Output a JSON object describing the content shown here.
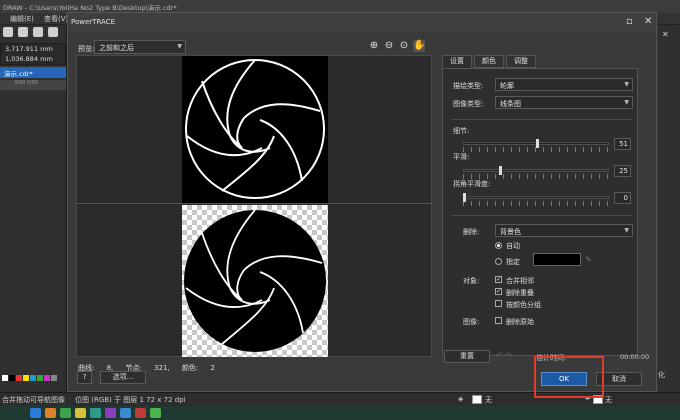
{
  "app": {
    "title": "DRAW - C:\\Users\\YoliHa No2 Type B\\Desktop\\演示.cdr*",
    "menu": [
      "编辑(E)",
      "查看(V)"
    ],
    "dim_w": "3,717.911 mm",
    "dim_h": "1,036.884 mm",
    "doc_tab": "演示.cdr*",
    "ruler_marks": "3/00   0/00",
    "right_text": "化",
    "status_left": "合并拖动可导航图像",
    "status_mid": "位图 (RGB) 于 图层 1 72 x 72 dpi",
    "status_fill": "无",
    "status_outline": "无",
    "colors": {
      "ok_blue": "#1c5aa6",
      "highlight_red": "#e23b2e",
      "doc_tab_blue": "#2566b8"
    }
  },
  "dialog": {
    "title": "PowerTRACE",
    "preview_label": "预览:",
    "preview_value": "之前和之后",
    "zoom_tools": [
      "zoom-in-icon",
      "zoom-out-icon",
      "zoom-fit-icon",
      "pan-hand-icon"
    ],
    "stats": {
      "curves_label": "曲线:",
      "curves_value": "8,",
      "nodes_label": "节点:",
      "nodes_value": "321,",
      "colors_label": "颜色:",
      "colors_value": "2"
    },
    "help_label": "?",
    "options_label": "选项...",
    "tabs": [
      "设置",
      "颜色",
      "调整"
    ],
    "settings": {
      "trace_type_label": "描绘类型:",
      "trace_type_value": "轮廓",
      "image_type_label": "图像类型:",
      "image_type_value": "线条图",
      "detail_label": "细节:",
      "detail_value": "51",
      "smoothing_label": "平滑:",
      "smoothing_value": "25",
      "corner_label": "拐角平滑度:",
      "corner_value": "0",
      "remove_label": "删除:",
      "remove_value": "背景色",
      "auto_label": "自动",
      "specify_label": "指定",
      "objects_label": "对象:",
      "merge_label": "合并相邻",
      "remove_overlap_label": "删除重叠",
      "group_by_color_label": "按颜色分组",
      "image_label": "图像:",
      "delete_original_label": "删除原始"
    },
    "reset_label": "重置",
    "est_label": "估计时间:",
    "est_value": "00:00:00",
    "ok_label": "OK",
    "cancel_label": "取消"
  }
}
